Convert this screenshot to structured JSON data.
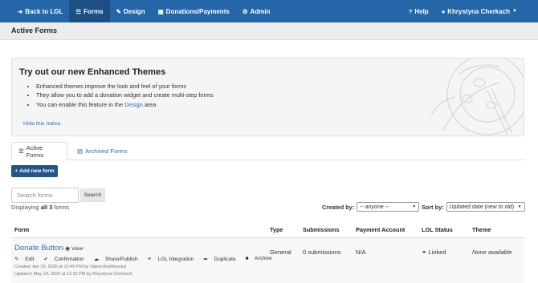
{
  "nav": {
    "back": "Back to LGL",
    "forms": "Forms",
    "design": "Design",
    "donations": "Donations/Payments",
    "admin": "Admin",
    "help": "Help",
    "user": "Khrystyna Cherkach"
  },
  "page_title": "Active Forms",
  "notice": {
    "title": "Try out our new Enhanced Themes",
    "items": [
      "Enhanced themes improve the look and feel of your forms",
      "They allow you to add a donation widget and create multi-step forms"
    ],
    "item3_prefix": "You can enable this feature in the ",
    "item3_link": "Design",
    "item3_suffix": " area",
    "hide": "Hide this notice"
  },
  "tabs": {
    "active": "Active Forms",
    "archived": "Archived Forms"
  },
  "add_button": "Add new form",
  "search": {
    "placeholder": "Search forms",
    "button": "Search"
  },
  "displaying": {
    "prefix": "Displaying ",
    "bold": "all 3",
    "suffix": " forms"
  },
  "filters": {
    "created_by_label": "Created by:",
    "created_by_value": "-- anyone --",
    "sort_label": "Sort by:",
    "sort_value": "Updated date (new to old)"
  },
  "table": {
    "headers": [
      "Form",
      "Type",
      "Submissions",
      "Payment Account",
      "LGL Status",
      "Theme"
    ],
    "rows": [
      {
        "name": "Donate Button",
        "view": "View",
        "actions": [
          "Edit",
          "Confirmation",
          "Share/Publish",
          "LGL Integration",
          "Duplicate",
          "Archive"
        ],
        "created": "Created: Apr 16, 2026 at 12:49 PM by Valerii Andriiovskyi",
        "updated": "Updated: May 19, 2026 at 12:32 PM by Khrystyna Cherkach",
        "type": "General",
        "submissions": "0 submissions",
        "payment": "N/A",
        "status": "Linked",
        "theme": "None available"
      }
    ]
  },
  "colors": {
    "nav": "#2466a8",
    "nav_active": "#1b4f86",
    "link": "#2a6db5",
    "button": "#24548a"
  }
}
